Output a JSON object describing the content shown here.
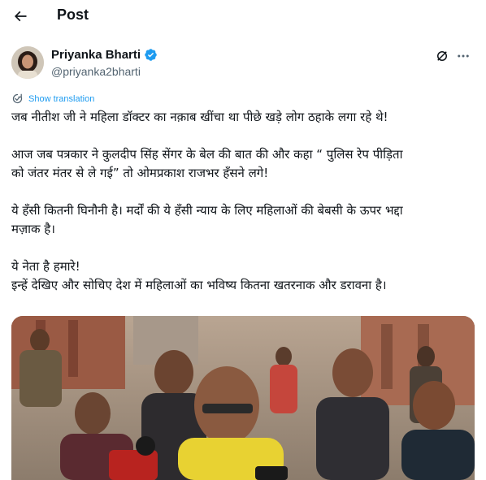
{
  "header": {
    "title": "Post"
  },
  "author": {
    "name": "Priyanka Bharti",
    "handle": "@priyanka2bharti"
  },
  "translate": {
    "label": "Show translation"
  },
  "tweet": {
    "line1": "जब नीतीश जी ने महिला डॉक्टर का नक़ाब खींचा था पीछे खड़े लोग ठहाके लगा रहे थे!",
    "line2": "आज जब पत्रकार ने कुलदीप सिंह सेंगर के बेल की बात की और कहा “ पुलिस रेप पीड़िता",
    "line3": "को जंतर मंतर से ले गई” तो ओमप्रकाश राजभर हँसने लगे!",
    "line4": "ये हँसी कितनी घिनौनी है। मर्दों की ये हँसी न्याय के लिए महिलाओं की बेबसी के ऊपर भद्दा",
    "line5": "मज़ाक है।",
    "line6": "ये नेता है हमारे!",
    "line7": "इन्हें देखिए और सोचिए देश में महिलाओं का भविष्य कितना खतरनाक और डरावना है।"
  },
  "colors": {
    "accent": "#1d9bf0",
    "text": "#0f1419",
    "muted": "#536471"
  }
}
